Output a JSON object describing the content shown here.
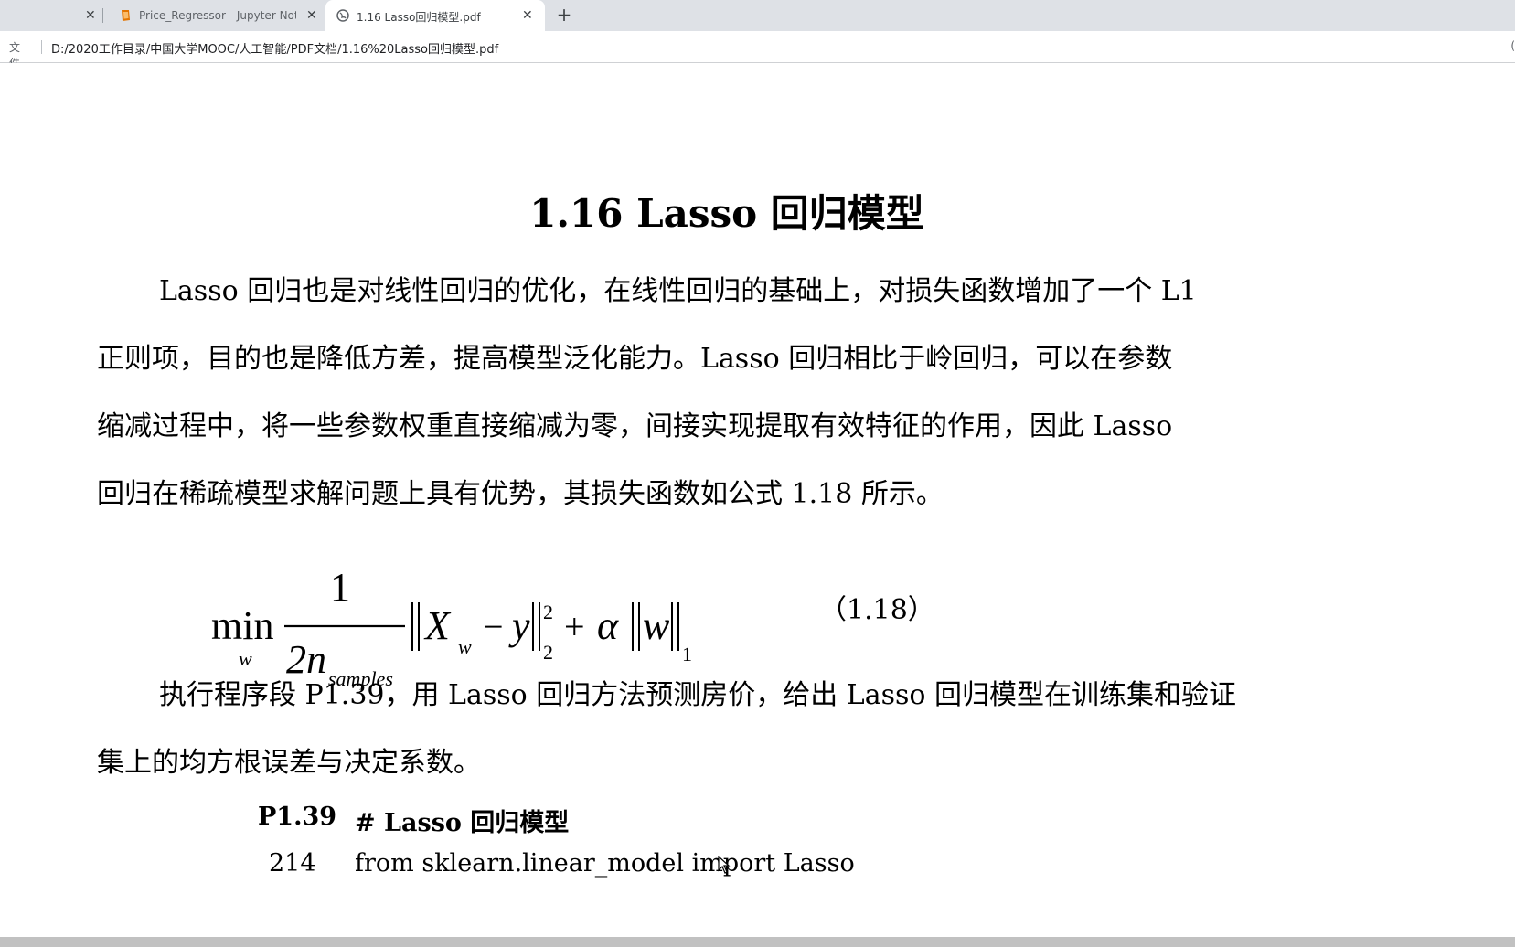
{
  "browser": {
    "tabs": [
      {
        "title": "",
        "active": false
      },
      {
        "title": "Price_Regressor - Jupyter Notebook",
        "active": false
      },
      {
        "title": "1.16 Lasso回归模型.pdf",
        "active": true
      }
    ],
    "new_tab_label": "+",
    "close_label": "✕",
    "address_bar": {
      "site_label": "文件",
      "url": "D:/2020工作目录/中国大学MOOC/人工智能/PDF文档/1.16%20Lasso回归模型.pdf"
    }
  },
  "document": {
    "title": "1.16 Lasso 回归模型",
    "paragraph1": [
      "Lasso 回归也是对线性回归的优化，在线性回归的基础上，对损失函数增加了一个 L1",
      "正则项，目的也是降低方差，提高模型泛化能力。Lasso 回归相比于岭回归，可以在参数",
      "缩减过程中，将一些参数权重直接缩减为零，间接实现提取有效特征的作用，因此 Lasso",
      "回归在稀疏模型求解问题上具有优势，其损失函数如公式 1.18 所示。"
    ],
    "formula": {
      "min": "min",
      "min_sub": "w",
      "numerator": "1",
      "denominator": "2n",
      "denominator_sub": "samples",
      "X": "X",
      "X_sub": "w",
      "minus": "−",
      "y": "y",
      "sup_2": "2",
      "sub_2": "2",
      "plus": "+",
      "alpha": "α",
      "w": "w",
      "sub_1": "1",
      "number": "（1.18）"
    },
    "paragraph2": [
      "执行程序段 P1.39，用 Lasso 回归方法预测房价，给出 Lasso 回归模型在训练集和验证",
      "集上的均方根误差与决定系数。"
    ],
    "code": {
      "label": "P1.39",
      "heading": "# Lasso 回归模型",
      "lines": [
        {
          "num": "214",
          "text": "from sklearn.linear_model import Lasso"
        }
      ]
    }
  },
  "colors": {
    "tabbar_bg": "#dee1e6",
    "active_tab_bg": "#ffffff",
    "notebook_icon": "#e37400",
    "scrollbar": "#c1c1c1"
  }
}
